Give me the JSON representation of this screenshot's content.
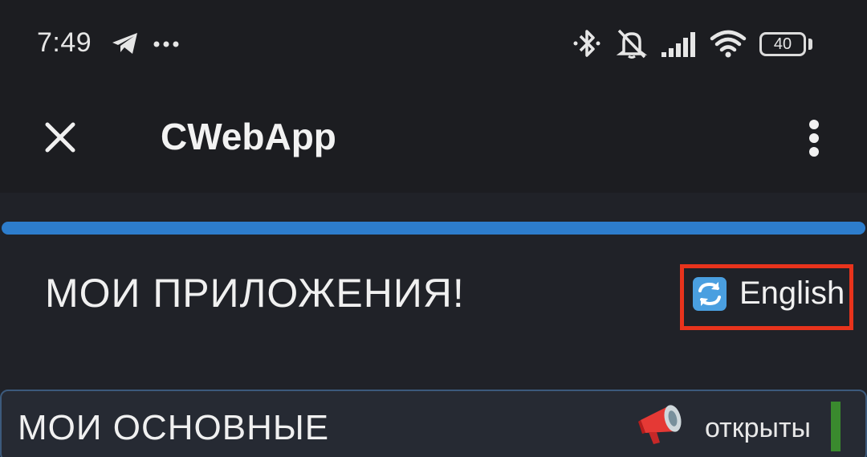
{
  "status_bar": {
    "time": "7:49",
    "battery": "40",
    "icons": [
      "telegram-icon",
      "more-notifications-icon",
      "bluetooth-icon",
      "mute-icon",
      "signal-icon",
      "wifi-icon",
      "battery-icon"
    ]
  },
  "app_bar": {
    "title": "CWebApp",
    "close_icon": "close-icon",
    "menu_icon": "more-vert-icon"
  },
  "main": {
    "heading": "МОИ ПРИЛОЖЕНИЯ!",
    "language_button": {
      "icon": "language-switch-icon",
      "label": "English"
    },
    "section": {
      "title": "МОИ ОСНОВНЫЕ",
      "icon": "megaphone-icon",
      "status": "открыты"
    }
  },
  "colors": {
    "accent": "#2d7dcc",
    "highlight": "#e8331c",
    "status_ok": "#3a8a2e"
  }
}
